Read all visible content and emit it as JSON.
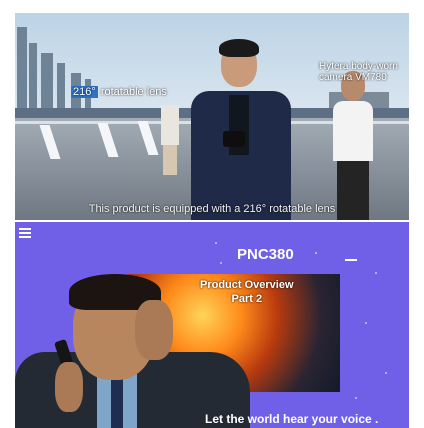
{
  "top_frame": {
    "lens_label_highlight": "216°",
    "lens_label_rest": "rotatable lens",
    "camera_label": "Hytera body-worn camera VM780",
    "caption": "This product is equipped with a 216° rotatable lens"
  },
  "bottom_frame": {
    "model": "PNC380",
    "overview_line1": "Product Overview",
    "overview_line2": "Part 2",
    "slogan": "Let the world hear your voice ."
  },
  "colors": {
    "bottom_background": "#7060e8",
    "lens_highlight": "#2f73c8"
  }
}
